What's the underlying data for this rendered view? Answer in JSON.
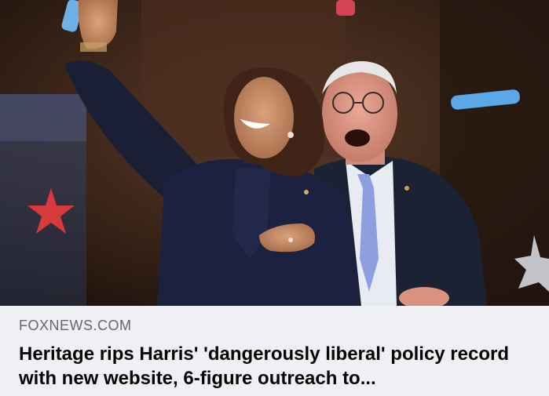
{
  "link_preview": {
    "source": "FOXNEWS.COM",
    "headline": "Heritage rips Harris' 'dangerously liberal' policy record with new website, 6-figure outreach to..."
  },
  "colors": {
    "caption_bg": "#eef0f3",
    "source_text": "#65676b",
    "headline_text": "#050505"
  }
}
